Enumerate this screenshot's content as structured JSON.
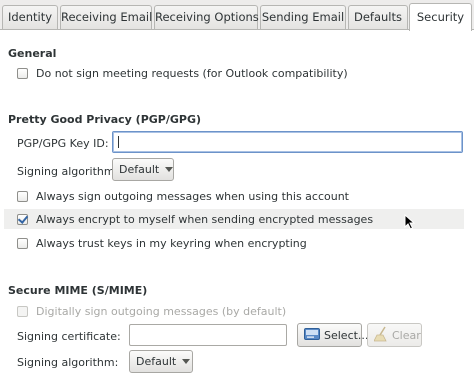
{
  "tabs": [
    {
      "label": "Identity"
    },
    {
      "label": "Receiving Email"
    },
    {
      "label": "Receiving Options"
    },
    {
      "label": "Sending Email"
    },
    {
      "label": "Defaults"
    },
    {
      "label": "Security",
      "active": true
    }
  ],
  "general": {
    "title": "General",
    "sign_meeting": {
      "label": "Do not sign meeting requests (for Outlook compatibility)",
      "checked": false
    }
  },
  "pgp": {
    "title": "Pretty Good Privacy (PGP/GPG)",
    "key_id": {
      "label": "PGP/GPG Key ID:",
      "value": ""
    },
    "signing_algorithm": {
      "label": "Signing algorithm:",
      "value": "Default"
    },
    "always_sign": {
      "label": "Always sign outgoing messages when using this account",
      "checked": false
    },
    "always_encrypt": {
      "label": "Always encrypt to myself when sending encrypted messages",
      "checked": true
    },
    "always_trust": {
      "label": "Always trust keys in my keyring when encrypting",
      "checked": false
    }
  },
  "smime": {
    "title": "Secure MIME (S/MIME)",
    "digitally_sign": {
      "label": "Digitally sign outgoing messages (by default)",
      "checked": false,
      "disabled": true
    },
    "signing_certificate": {
      "label": "Signing certificate:",
      "value": ""
    },
    "select_button": "Select...",
    "clear_button": "Clear",
    "signing_algorithm": {
      "label": "Signing algorithm:",
      "value": "Default"
    }
  },
  "icons": {
    "select": "certificate-card-icon",
    "clear": "broom-clear-icon",
    "cursor": "mouse-pointer-icon"
  },
  "colors": {
    "focus_border": "#6c93c9",
    "check_mark": "#3465a4",
    "hover_row": "#efefee",
    "disabled_text": "#a9a9a6"
  }
}
